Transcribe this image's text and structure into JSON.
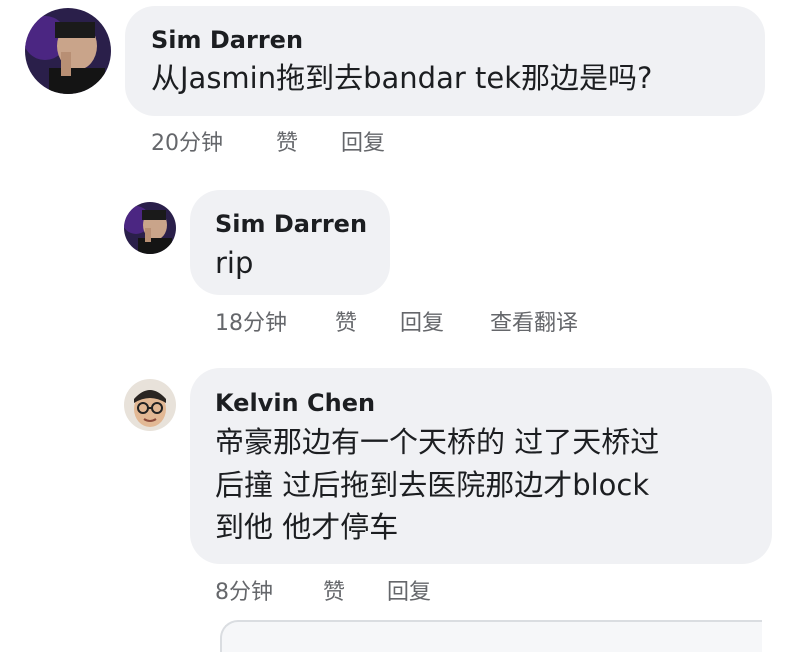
{
  "comments": [
    {
      "author": "Sim Darren",
      "text_lines": [
        "从Jasmin拖到去bandar tek那边是吗?"
      ],
      "time": "20分钟",
      "like_label": "赞",
      "reply_label": "回复"
    },
    {
      "author": "Sim Darren",
      "text_lines": [
        "rip"
      ],
      "time": "18分钟",
      "like_label": "赞",
      "reply_label": "回复",
      "translate_label": "查看翻译"
    },
    {
      "author": "Kelvin Chen",
      "text_lines": [
        "帝豪那边有一个天桥的 过了天桥过",
        "后撞 过后拖到去医院那边才block",
        "到他 他才停车"
      ],
      "time": "8分钟",
      "like_label": "赞",
      "reply_label": "回复"
    }
  ],
  "colors": {
    "bubble": "#f0f1f4",
    "text": "#1c1e21",
    "meta": "#65676b"
  },
  "icons": {
    "avatar_1": "user-photo-dark",
    "avatar_2": "user-photo-dark",
    "avatar_3": "user-photo-glasses"
  }
}
